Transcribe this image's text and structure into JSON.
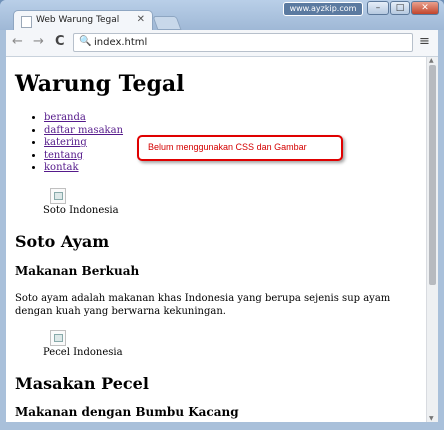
{
  "browser": {
    "tab_title": "Web Warung Tegal",
    "tab_close": "✕",
    "watermark": "www.ayzkip.com",
    "window_buttons": {
      "minimize": "–",
      "maximize": "□",
      "close": "✕"
    },
    "back": "←",
    "forward": "→",
    "reload": "C",
    "search_icon": "🔍",
    "address": "index.html",
    "menu": "≡"
  },
  "page": {
    "title": "Warung Tegal",
    "nav": [
      "beranda",
      "daftar masakan",
      "katering",
      "tentang",
      "kontak"
    ],
    "sections": [
      {
        "image_caption": "Soto Indonesia",
        "heading": "Soto Ayam",
        "subheading": "Makanan Berkuah",
        "description": "Soto ayam adalah makanan khas Indonesia yang berupa sejenis sup ayam dengan kuah yang berwarna kekuningan."
      },
      {
        "image_caption": "Pecel Indonesia",
        "heading": "Masakan Pecel",
        "subheading": "Makanan dengan Bumbu Kacang"
      }
    ]
  },
  "callout": "Belum menggunakan CSS dan Gambar"
}
